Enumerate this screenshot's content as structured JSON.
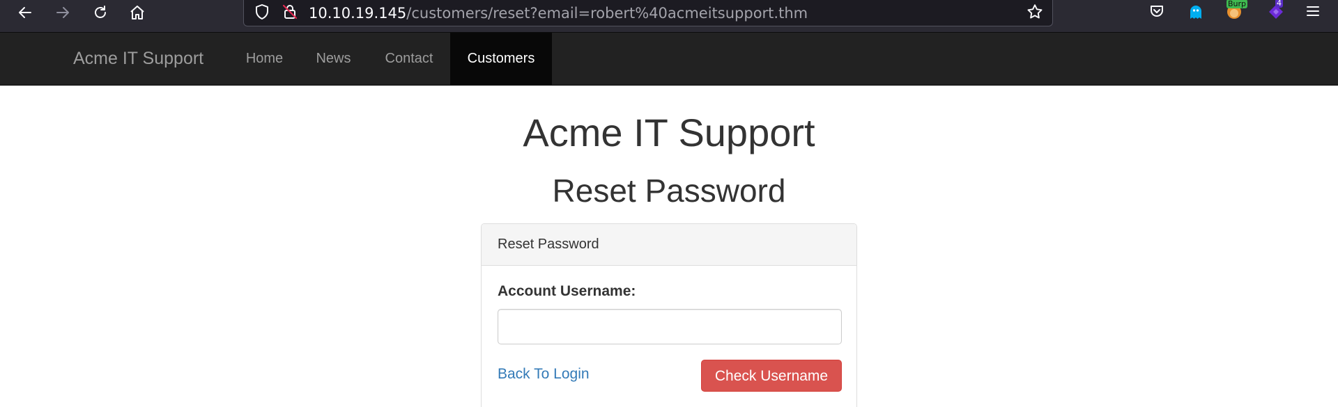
{
  "browser": {
    "url_host": "10.10.19.145",
    "url_path": "/customers/reset?email=robert%40acmeitsupport.thm",
    "extensions": {
      "burp_badge": "Burp",
      "count_badge": "4"
    }
  },
  "navbar": {
    "brand": "Acme IT Support",
    "items": [
      {
        "label": "Home"
      },
      {
        "label": "News"
      },
      {
        "label": "Contact"
      },
      {
        "label": "Customers"
      }
    ]
  },
  "page": {
    "title": "Acme IT Support",
    "subtitle": "Reset Password",
    "panel": {
      "heading": "Reset Password",
      "username_label": "Account Username:",
      "username_value": "",
      "back_link": "Back To Login",
      "submit_label": "Check Username"
    }
  },
  "colors": {
    "navbar_bg": "#222222",
    "active_nav_bg": "#080808",
    "link": "#337ab7",
    "danger_button": "#d9534f"
  }
}
